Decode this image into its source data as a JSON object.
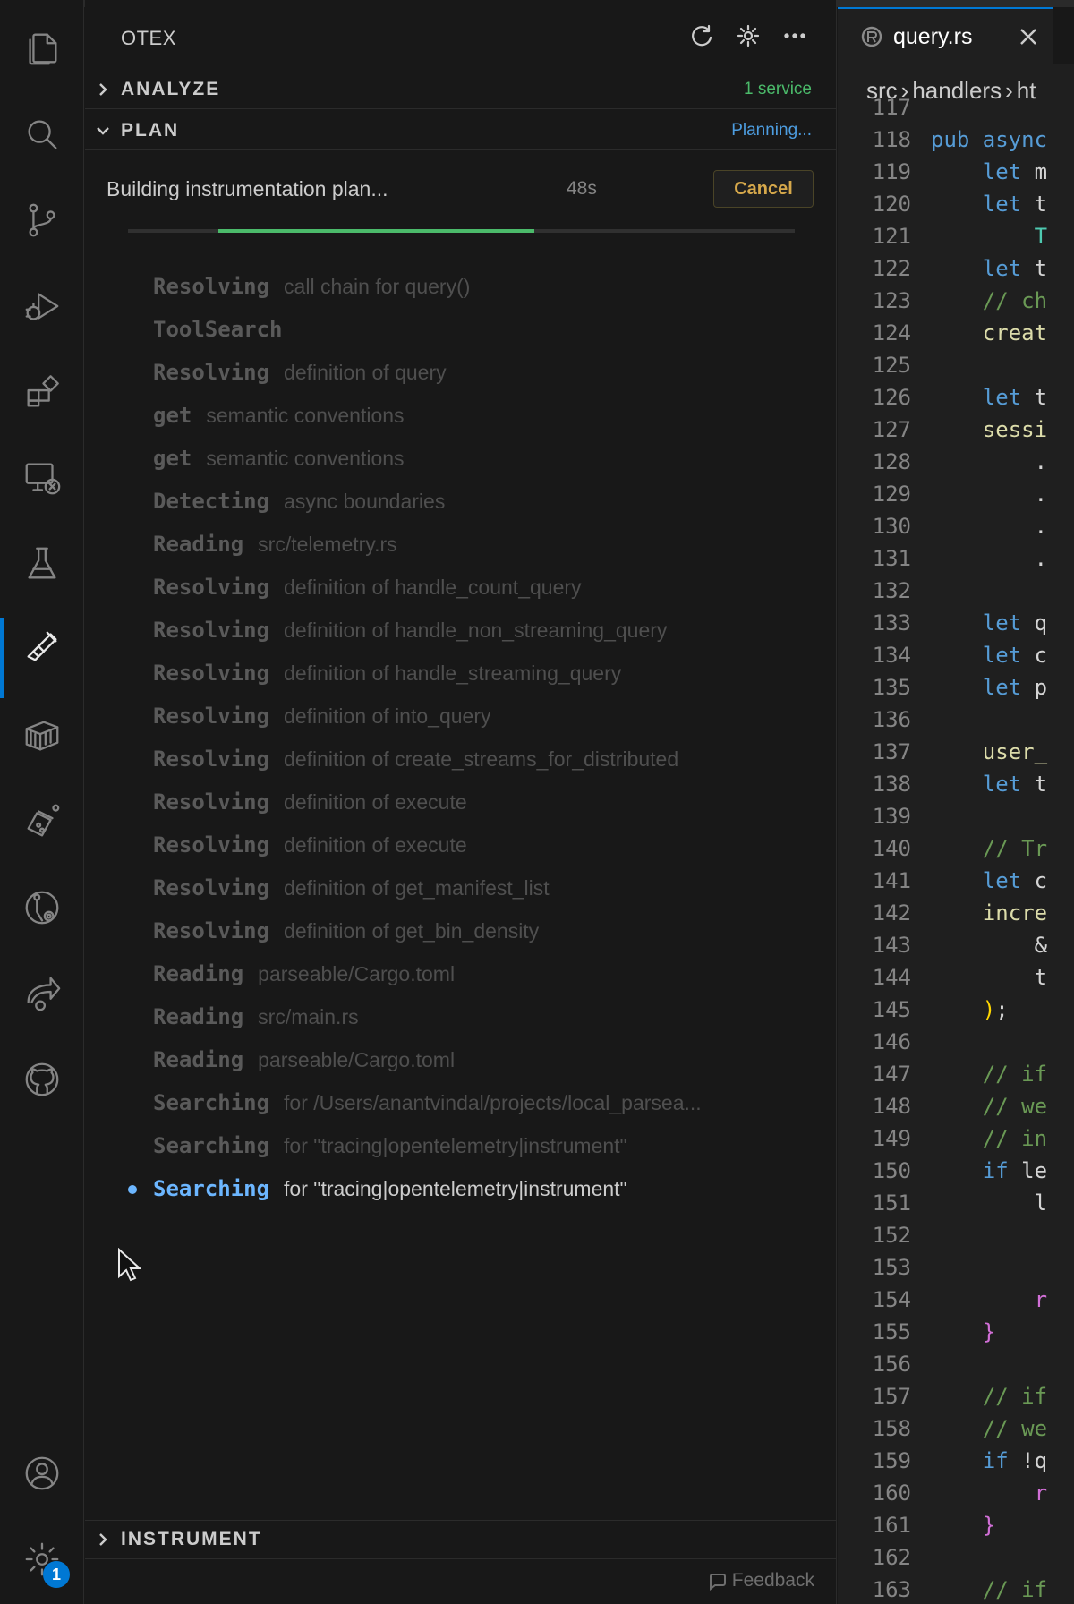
{
  "activity_bar": {
    "icons": [
      "files-icon",
      "search-icon",
      "source-control-icon",
      "run-debug-icon",
      "extensions-icon",
      "remote-explorer-icon",
      "testing-icon",
      "otex-icon",
      "container-icon",
      "flask-icon",
      "timeline-icon",
      "share-icon",
      "github-icon",
      "account-icon",
      "settings-gear-icon"
    ],
    "settings_badge": "1"
  },
  "panel": {
    "title": "OTEX",
    "actions": [
      "refresh-icon",
      "gear-icon",
      "more-icon"
    ]
  },
  "analyze": {
    "label": "ANALYZE",
    "status": "1 service",
    "status_color": "#4bba6a"
  },
  "plan": {
    "label": "PLAN",
    "status": "Planning...",
    "status_color": "#4d9de0",
    "progress_text": "Building instrumentation plan...",
    "elapsed": "48s",
    "cancel_label": "Cancel",
    "progress_fraction": {
      "start": 0.135,
      "end": 0.61
    },
    "steps": [
      {
        "verb": "Resolving",
        "detail": "call chain for query()"
      },
      {
        "verb": "ToolSearch",
        "detail": ""
      },
      {
        "verb": "Resolving",
        "detail": "definition of query"
      },
      {
        "verb": "get",
        "detail": "semantic conventions"
      },
      {
        "verb": "get",
        "detail": "semantic conventions"
      },
      {
        "verb": "Detecting",
        "detail": "async boundaries"
      },
      {
        "verb": "Reading",
        "detail": "src/telemetry.rs"
      },
      {
        "verb": "Resolving",
        "detail": "definition of handle_count_query"
      },
      {
        "verb": "Resolving",
        "detail": "definition of handle_non_streaming_query"
      },
      {
        "verb": "Resolving",
        "detail": "definition of handle_streaming_query"
      },
      {
        "verb": "Resolving",
        "detail": "definition of into_query"
      },
      {
        "verb": "Resolving",
        "detail": "definition of create_streams_for_distributed"
      },
      {
        "verb": "Resolving",
        "detail": "definition of execute"
      },
      {
        "verb": "Resolving",
        "detail": "definition of execute"
      },
      {
        "verb": "Resolving",
        "detail": "definition of get_manifest_list"
      },
      {
        "verb": "Resolving",
        "detail": "definition of get_bin_density"
      },
      {
        "verb": "Reading",
        "detail": "parseable/Cargo.toml"
      },
      {
        "verb": "Reading",
        "detail": "src/main.rs"
      },
      {
        "verb": "Reading",
        "detail": "parseable/Cargo.toml"
      },
      {
        "verb": "Searching",
        "detail": "for /Users/anantvindal/projects/local_parsea..."
      },
      {
        "verb": "Searching",
        "detail": "for \"tracing|opentelemetry|instrument\""
      },
      {
        "verb": "Searching",
        "detail": "for \"tracing|opentelemetry|instrument\"",
        "current": true
      }
    ]
  },
  "instrument": {
    "label": "INSTRUMENT"
  },
  "feedback_label": "Feedback",
  "editor": {
    "tab_name": "query.rs",
    "breadcrumb": [
      "src",
      "handlers",
      "ht"
    ],
    "lines": [
      {
        "n": "117",
        "code": [
          [
            "pl",
            ""
          ]
        ]
      },
      {
        "n": "118",
        "code": [
          [
            "kw",
            "pub async"
          ]
        ]
      },
      {
        "n": "119",
        "code": [
          [
            "kw",
            "    let "
          ],
          [
            "pl",
            "m"
          ]
        ]
      },
      {
        "n": "120",
        "code": [
          [
            "kw",
            "    let "
          ],
          [
            "pl",
            "t"
          ]
        ]
      },
      {
        "n": "121",
        "code": [
          [
            "ty",
            "        T"
          ]
        ]
      },
      {
        "n": "122",
        "code": [
          [
            "kw",
            "    let "
          ],
          [
            "pl",
            "t"
          ]
        ]
      },
      {
        "n": "123",
        "code": [
          [
            "cm",
            "    // ch"
          ]
        ]
      },
      {
        "n": "124",
        "code": [
          [
            "fn",
            "    creat"
          ]
        ]
      },
      {
        "n": "125",
        "code": [
          [
            "pl",
            ""
          ]
        ]
      },
      {
        "n": "126",
        "code": [
          [
            "kw",
            "    let "
          ],
          [
            "pl",
            "t"
          ]
        ]
      },
      {
        "n": "127",
        "code": [
          [
            "fn",
            "    sessi"
          ]
        ]
      },
      {
        "n": "128",
        "code": [
          [
            "pl",
            "        ."
          ]
        ]
      },
      {
        "n": "129",
        "code": [
          [
            "pl",
            "        ."
          ]
        ]
      },
      {
        "n": "130",
        "code": [
          [
            "pl",
            "        ."
          ]
        ]
      },
      {
        "n": "131",
        "code": [
          [
            "pl",
            "        ."
          ]
        ]
      },
      {
        "n": "132",
        "code": [
          [
            "pl",
            ""
          ]
        ]
      },
      {
        "n": "133",
        "code": [
          [
            "kw",
            "    let "
          ],
          [
            "pl",
            "q"
          ]
        ]
      },
      {
        "n": "134",
        "code": [
          [
            "kw",
            "    let "
          ],
          [
            "pl",
            "c"
          ]
        ]
      },
      {
        "n": "135",
        "code": [
          [
            "kw",
            "    let "
          ],
          [
            "pl",
            "p"
          ]
        ]
      },
      {
        "n": "136",
        "code": [
          [
            "pl",
            ""
          ]
        ]
      },
      {
        "n": "137",
        "code": [
          [
            "fn",
            "    user_"
          ]
        ]
      },
      {
        "n": "138",
        "code": [
          [
            "kw",
            "    let "
          ],
          [
            "pl",
            "t"
          ]
        ]
      },
      {
        "n": "139",
        "code": [
          [
            "pl",
            ""
          ]
        ]
      },
      {
        "n": "140",
        "code": [
          [
            "cm",
            "    // Tr"
          ]
        ]
      },
      {
        "n": "141",
        "code": [
          [
            "kw",
            "    let "
          ],
          [
            "pl",
            "c"
          ]
        ]
      },
      {
        "n": "142",
        "code": [
          [
            "fn",
            "    incre"
          ]
        ]
      },
      {
        "n": "143",
        "code": [
          [
            "pl",
            "        &"
          ]
        ]
      },
      {
        "n": "144",
        "code": [
          [
            "pl",
            "        t"
          ]
        ]
      },
      {
        "n": "145",
        "code": [
          [
            "br2",
            "    )"
          ],
          [
            "pl",
            ";"
          ]
        ]
      },
      {
        "n": "146",
        "code": [
          [
            "pl",
            ""
          ]
        ]
      },
      {
        "n": "147",
        "code": [
          [
            "cm",
            "    // if"
          ]
        ]
      },
      {
        "n": "148",
        "code": [
          [
            "cm",
            "    // we"
          ]
        ]
      },
      {
        "n": "149",
        "code": [
          [
            "cm",
            "    // in"
          ]
        ]
      },
      {
        "n": "150",
        "code": [
          [
            "kw",
            "    if "
          ],
          [
            "pl",
            "le"
          ]
        ]
      },
      {
        "n": "151",
        "code": [
          [
            "pl",
            "        l"
          ]
        ]
      },
      {
        "n": "152",
        "code": [
          [
            "pl",
            ""
          ]
        ]
      },
      {
        "n": "153",
        "code": [
          [
            "pl",
            ""
          ]
        ]
      },
      {
        "n": "154",
        "code": [
          [
            "br",
            "        r"
          ]
        ]
      },
      {
        "n": "155",
        "code": [
          [
            "br",
            "    }"
          ]
        ]
      },
      {
        "n": "156",
        "code": [
          [
            "pl",
            ""
          ]
        ]
      },
      {
        "n": "157",
        "code": [
          [
            "cm",
            "    // if"
          ]
        ]
      },
      {
        "n": "158",
        "code": [
          [
            "cm",
            "    // we"
          ]
        ]
      },
      {
        "n": "159",
        "code": [
          [
            "kw",
            "    if "
          ],
          [
            "pl",
            "!q"
          ]
        ]
      },
      {
        "n": "160",
        "code": [
          [
            "br",
            "        r"
          ]
        ]
      },
      {
        "n": "161",
        "code": [
          [
            "br",
            "    }"
          ]
        ]
      },
      {
        "n": "162",
        "code": [
          [
            "pl",
            ""
          ]
        ]
      },
      {
        "n": "163",
        "code": [
          [
            "cm",
            "    // if"
          ]
        ]
      }
    ]
  }
}
